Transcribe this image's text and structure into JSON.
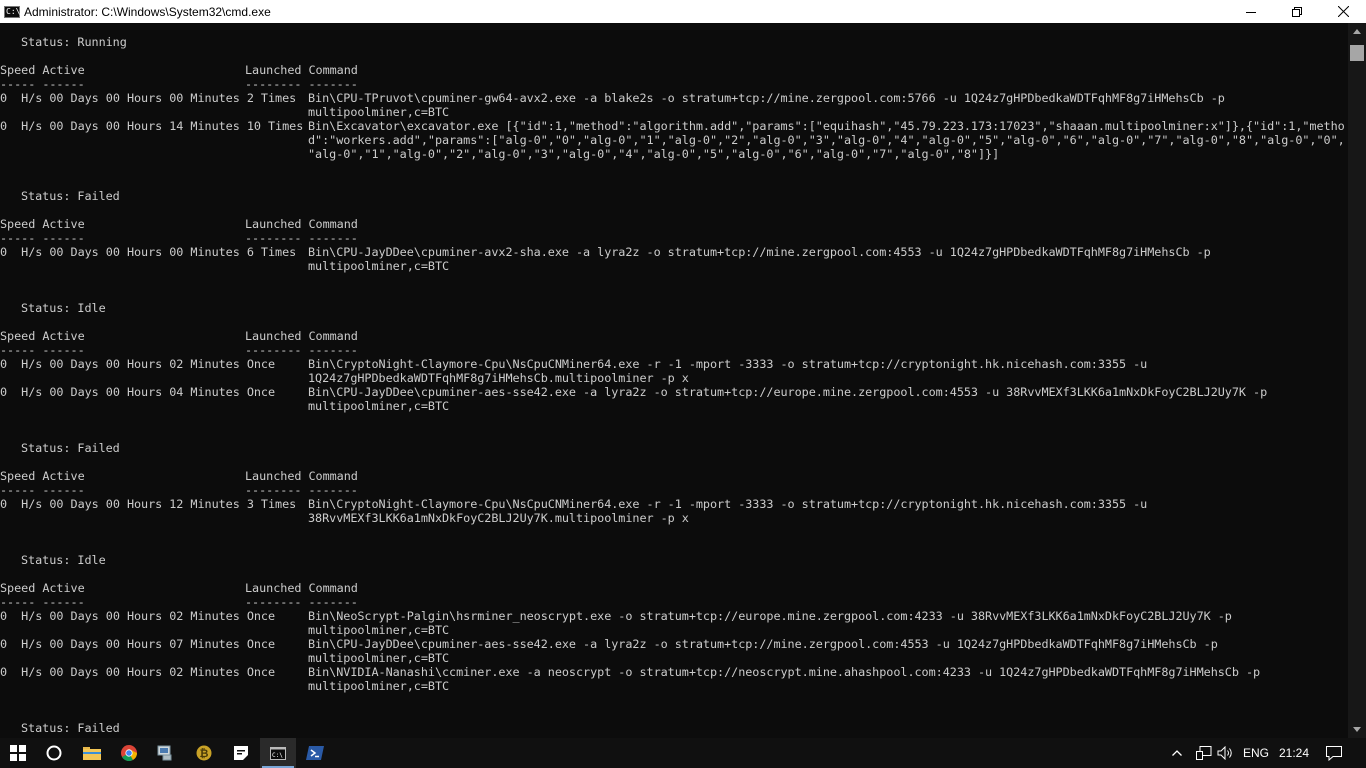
{
  "window": {
    "title": "Administrator: C:\\Windows\\System32\\cmd.exe",
    "app_icon_text": "C:\\"
  },
  "console": {
    "lines": [
      {
        "row": 1,
        "col": 1,
        "text": "Status: Running"
      },
      {
        "row": 3,
        "col": 0,
        "text": "Speed Active"
      },
      {
        "row": 3,
        "col": 2,
        "text": "Launched Command"
      },
      {
        "row": 4,
        "col": 0,
        "text": "----- ------"
      },
      {
        "row": 4,
        "col": 2,
        "text": "-------- -------"
      },
      {
        "row": 5,
        "col": 0,
        "text": "0  H/s 00 Days 00 Hours 00 Minutes 2 Times"
      },
      {
        "row": 5,
        "col": 3,
        "text": "Bin\\CPU-TPruvot\\cpuminer-gw64-avx2.exe -a blake2s -o stratum+tcp://mine.zergpool.com:5766 -u 1Q24z7gHPDbedkaWDTFqhMF8g7iHMehsCb -p"
      },
      {
        "row": 6,
        "col": 3,
        "text": "multipoolminer,c=BTC"
      },
      {
        "row": 7,
        "col": 0,
        "text": "0  H/s 00 Days 00 Hours 14 Minutes 10 Times"
      },
      {
        "row": 7,
        "col": 3,
        "text": "Bin\\Excavator\\excavator.exe [{\"id\":1,\"method\":\"algorithm.add\",\"params\":[\"equihash\",\"45.79.223.173:17023\",\"shaaan.multipoolminer:x\"]},{\"id\":1,\"metho"
      },
      {
        "row": 8,
        "col": 3,
        "text": "d\":\"workers.add\",\"params\":[\"alg-0\",\"0\",\"alg-0\",\"1\",\"alg-0\",\"2\",\"alg-0\",\"3\",\"alg-0\",\"4\",\"alg-0\",\"5\",\"alg-0\",\"6\",\"alg-0\",\"7\",\"alg-0\",\"8\",\"alg-0\",\"0\","
      },
      {
        "row": 9,
        "col": 3,
        "text": "\"alg-0\",\"1\",\"alg-0\",\"2\",\"alg-0\",\"3\",\"alg-0\",\"4\",\"alg-0\",\"5\",\"alg-0\",\"6\",\"alg-0\",\"7\",\"alg-0\",\"8\"]}]"
      },
      {
        "row": 12,
        "col": 1,
        "text": "Status: Failed"
      },
      {
        "row": 14,
        "col": 0,
        "text": "Speed Active"
      },
      {
        "row": 14,
        "col": 2,
        "text": "Launched Command"
      },
      {
        "row": 15,
        "col": 0,
        "text": "----- ------"
      },
      {
        "row": 15,
        "col": 2,
        "text": "-------- -------"
      },
      {
        "row": 16,
        "col": 0,
        "text": "0  H/s 00 Days 00 Hours 00 Minutes 6 Times"
      },
      {
        "row": 16,
        "col": 3,
        "text": "Bin\\CPU-JayDDee\\cpuminer-avx2-sha.exe -a lyra2z -o stratum+tcp://mine.zergpool.com:4553 -u 1Q24z7gHPDbedkaWDTFqhMF8g7iHMehsCb -p"
      },
      {
        "row": 17,
        "col": 3,
        "text": "multipoolminer,c=BTC"
      },
      {
        "row": 20,
        "col": 1,
        "text": "Status: Idle"
      },
      {
        "row": 22,
        "col": 0,
        "text": "Speed Active"
      },
      {
        "row": 22,
        "col": 2,
        "text": "Launched Command"
      },
      {
        "row": 23,
        "col": 0,
        "text": "----- ------"
      },
      {
        "row": 23,
        "col": 2,
        "text": "-------- -------"
      },
      {
        "row": 24,
        "col": 0,
        "text": "0  H/s 00 Days 00 Hours 02 Minutes Once"
      },
      {
        "row": 24,
        "col": 3,
        "text": "Bin\\CryptoNight-Claymore-Cpu\\NsCpuCNMiner64.exe -r -1 -mport -3333 -o stratum+tcp://cryptonight.hk.nicehash.com:3355 -u"
      },
      {
        "row": 25,
        "col": 3,
        "text": "1Q24z7gHPDbedkaWDTFqhMF8g7iHMehsCb.multipoolminer -p x"
      },
      {
        "row": 26,
        "col": 0,
        "text": "0  H/s 00 Days 00 Hours 04 Minutes Once"
      },
      {
        "row": 26,
        "col": 3,
        "text": "Bin\\CPU-JayDDee\\cpuminer-aes-sse42.exe -a lyra2z -o stratum+tcp://europe.mine.zergpool.com:4553 -u 38RvvMEXf3LKK6a1mNxDkFoyC2BLJ2Uy7K -p"
      },
      {
        "row": 27,
        "col": 3,
        "text": "multipoolminer,c=BTC"
      },
      {
        "row": 30,
        "col": 1,
        "text": "Status: Failed"
      },
      {
        "row": 32,
        "col": 0,
        "text": "Speed Active"
      },
      {
        "row": 32,
        "col": 2,
        "text": "Launched Command"
      },
      {
        "row": 33,
        "col": 0,
        "text": "----- ------"
      },
      {
        "row": 33,
        "col": 2,
        "text": "-------- -------"
      },
      {
        "row": 34,
        "col": 0,
        "text": "0  H/s 00 Days 00 Hours 12 Minutes 3 Times"
      },
      {
        "row": 34,
        "col": 3,
        "text": "Bin\\CryptoNight-Claymore-Cpu\\NsCpuCNMiner64.exe -r -1 -mport -3333 -o stratum+tcp://cryptonight.hk.nicehash.com:3355 -u"
      },
      {
        "row": 35,
        "col": 3,
        "text": "38RvvMEXf3LKK6a1mNxDkFoyC2BLJ2Uy7K.multipoolminer -p x"
      },
      {
        "row": 38,
        "col": 1,
        "text": "Status: Idle"
      },
      {
        "row": 40,
        "col": 0,
        "text": "Speed Active"
      },
      {
        "row": 40,
        "col": 2,
        "text": "Launched Command"
      },
      {
        "row": 41,
        "col": 0,
        "text": "----- ------"
      },
      {
        "row": 41,
        "col": 2,
        "text": "-------- -------"
      },
      {
        "row": 42,
        "col": 0,
        "text": "0  H/s 00 Days 00 Hours 02 Minutes Once"
      },
      {
        "row": 42,
        "col": 3,
        "text": "Bin\\NeoScrypt-Palgin\\hsrminer_neoscrypt.exe -o stratum+tcp://europe.mine.zergpool.com:4233 -u 38RvvMEXf3LKK6a1mNxDkFoyC2BLJ2Uy7K -p"
      },
      {
        "row": 43,
        "col": 3,
        "text": "multipoolminer,c=BTC"
      },
      {
        "row": 44,
        "col": 0,
        "text": "0  H/s 00 Days 00 Hours 07 Minutes Once"
      },
      {
        "row": 44,
        "col": 3,
        "text": "Bin\\CPU-JayDDee\\cpuminer-aes-sse42.exe -a lyra2z -o stratum+tcp://mine.zergpool.com:4553 -u 1Q24z7gHPDbedkaWDTFqhMF8g7iHMehsCb -p"
      },
      {
        "row": 45,
        "col": 3,
        "text": "multipoolminer,c=BTC"
      },
      {
        "row": 46,
        "col": 0,
        "text": "0  H/s 00 Days 00 Hours 02 Minutes Once"
      },
      {
        "row": 46,
        "col": 3,
        "text": "Bin\\NVIDIA-Nanashi\\ccminer.exe -a neoscrypt -o stratum+tcp://neoscrypt.mine.ahashpool.com:4233 -u 1Q24z7gHPDbedkaWDTFqhMF8g7iHMehsCb -p"
      },
      {
        "row": 47,
        "col": 3,
        "text": "multipoolminer,c=BTC"
      },
      {
        "row": 50,
        "col": 1,
        "text": "Status: Failed"
      }
    ]
  },
  "taskbar": {
    "apps": [
      {
        "name": "start-button",
        "icon": "windows-logo-icon"
      },
      {
        "name": "cortana-button",
        "icon": "cortana-circle-icon"
      },
      {
        "name": "file-explorer",
        "icon": "folder-icon"
      },
      {
        "name": "chrome",
        "icon": "chrome-icon"
      },
      {
        "name": "network-app",
        "icon": "network-computer-icon"
      },
      {
        "name": "bitcoin-wallet",
        "icon": "bitcoin-icon"
      },
      {
        "name": "sticky-notes",
        "icon": "note-icon"
      },
      {
        "name": "cmd",
        "icon": "cmd-icon",
        "active": true
      },
      {
        "name": "powershell",
        "icon": "powershell-icon"
      }
    ],
    "tray": {
      "language": "ENG",
      "clock": "21:24"
    }
  },
  "colors": {
    "console_bg": "#0c0c0c",
    "console_fg": "#cccccc",
    "taskbar_bg": "#101010",
    "titlebar_bg": "#ffffff"
  }
}
